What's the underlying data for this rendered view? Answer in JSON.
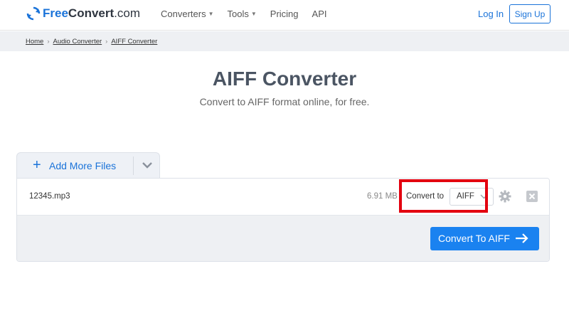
{
  "brand": {
    "free": "Free",
    "rest": "Convert",
    "tld": ".com",
    "accent": "#1a73d9"
  },
  "nav": {
    "items": [
      {
        "label": "Converters",
        "has_caret": true
      },
      {
        "label": "Tools",
        "has_caret": true
      },
      {
        "label": "Pricing",
        "has_caret": false
      },
      {
        "label": "API",
        "has_caret": false
      }
    ],
    "login": "Log In",
    "signup": "Sign Up"
  },
  "breadcrumb": {
    "items": [
      "Home",
      "Audio Converter",
      "AIFF Converter"
    ],
    "separator": "›"
  },
  "page": {
    "title": "AIFF Converter",
    "subtitle": "Convert to AIFF format online, for free."
  },
  "uploader": {
    "add_label": "Add More Files",
    "file": {
      "name": "12345.mp3",
      "size": "6.91 MB",
      "convert_to_label": "Convert to",
      "format": "AIFF"
    },
    "convert_button": "Convert To AIFF"
  },
  "icons": {
    "logo": "refresh-icon",
    "add": "plus-icon",
    "dropdown": "chevron-down-icon",
    "settings": "gear-icon",
    "remove": "close-icon",
    "convert": "arrow-right-icon"
  },
  "colors": {
    "primary_button": "#1a82f0",
    "highlight_box": "#e3000f"
  }
}
